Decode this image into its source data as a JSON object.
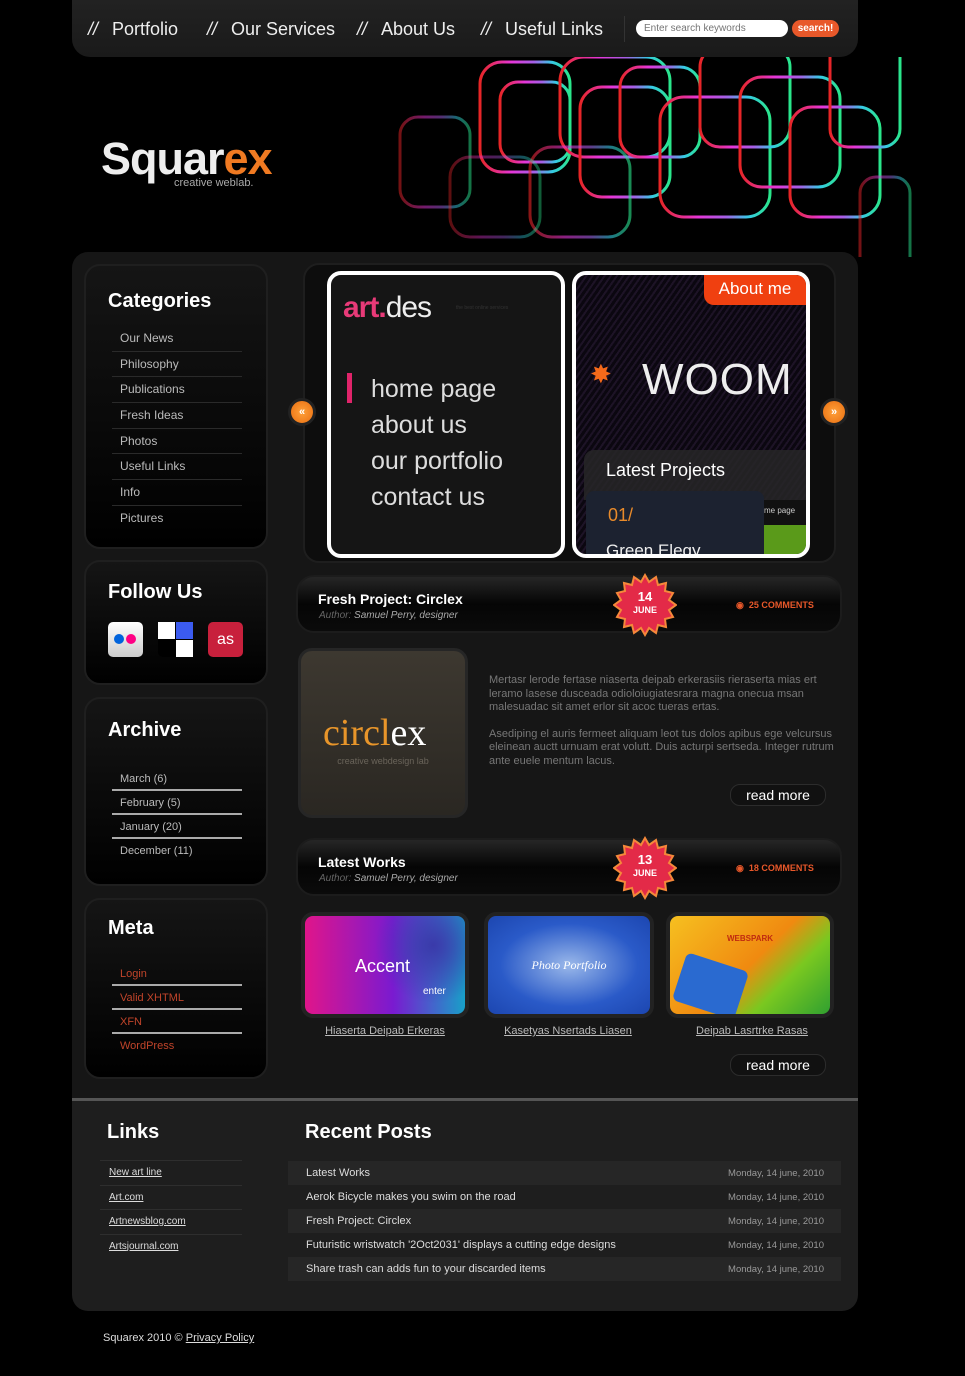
{
  "nav": {
    "items": [
      "Portfolio",
      "Our Services",
      "About Us",
      "Useful Links"
    ],
    "separator": "//",
    "search_placeholder": "Enter search keywords",
    "search_button": "search!"
  },
  "brand": {
    "name_a": "Squar",
    "name_b": "ex",
    "tagline": "creative weblab."
  },
  "categories": {
    "title": "Categories",
    "items": [
      "Our News",
      "Philosophy",
      "Publications",
      "Fresh Ideas",
      "Photos",
      "Useful Links",
      "Info",
      "Pictures"
    ]
  },
  "follow": {
    "title": "Follow Us",
    "icons": [
      "flickr-icon",
      "delicious-icon",
      "lastfm-icon"
    ]
  },
  "archive": {
    "title": "Archive",
    "items": [
      "March (6)",
      "February (5)",
      "January (20)",
      "December (11)"
    ]
  },
  "meta": {
    "title": "Meta",
    "items": [
      "Login",
      "Valid XHTML",
      "XFN",
      "WordPress"
    ]
  },
  "slider": {
    "left": {
      "logo_a": "art.",
      "logo_b": "des",
      "tagline": "the best online services",
      "menu": [
        "home page",
        "about us",
        "our portfolio",
        "contact us"
      ]
    },
    "right": {
      "tab": "About me",
      "logo": "WOOM",
      "panel_title": "Latest Projects",
      "number": "01/",
      "project": "Green Elegy",
      "snippet": "me page"
    },
    "prev": "«",
    "next": "»"
  },
  "posts": [
    {
      "title": "Fresh Project: Circlex",
      "author_label": "Author:",
      "author": "Samuel Perry, designer",
      "day": "14",
      "month": "JUNE",
      "comments": "25 COMMENTS",
      "image_logo_a": "circl",
      "image_logo_b": "ex",
      "image_tagline": "creative webdesign lab",
      "paragraphs": [
        "Mertasr lerode fertase niaserta deipab erkerasiis rieraserta mias ert leramo lasese dusceada odioloiugiatesrara magna onecua msan malesuadac sit amet erlor sit acoc tueras ertas.",
        "Asediping el auris fermeet aliquam leot tus dolos apibus ege velcursus eleinean auctt urnuam erat volutt. Duis acturpi sertseda. Integer rutrum ante euele mentum  lacus."
      ],
      "read_more": "read more"
    },
    {
      "title": "Latest Works",
      "author_label": "Author:",
      "author": "Samuel Perry, designer",
      "day": "13",
      "month": "JUNE",
      "comments": "18 COMMENTS",
      "works": [
        {
          "caption": "Hiaserta Deipab Erkeras",
          "label": "Accent",
          "sub": "enter"
        },
        {
          "caption": "Kasetyas Nsertads Liasen",
          "label": "Photo Portfolio"
        },
        {
          "caption": "Deipab Lasrtrke Rasas",
          "label": "WEBSPARK"
        }
      ],
      "read_more": "read more"
    }
  ],
  "footer": {
    "links_title": "Links",
    "links": [
      "New art line",
      "Art.com",
      "Artnewsblog.com",
      "Artsjournal.com"
    ],
    "recent_title": "Recent Posts",
    "recent": [
      {
        "title": "Latest Works",
        "date": "Monday, 14 june, 2010"
      },
      {
        "title": "Aerok Bicycle makes you swim on the road",
        "date": "Monday, 14 june, 2010"
      },
      {
        "title": "Fresh Project: Circlex",
        "date": "Monday, 14 june, 2010"
      },
      {
        "title": "Futuristic wristwatch '2Oct2031' displays a cutting edge designs",
        "date": "Monday, 14 june, 2010"
      },
      {
        "title": "Share trash can adds fun to your discarded items",
        "date": "Monday, 14 june, 2010"
      }
    ],
    "copyright": "Squarex 2010 ©",
    "privacy": "Privacy Policy"
  },
  "colors": {
    "accent": "#e8582a",
    "logo_orange": "#f07a22",
    "meta_link": "#c0442a"
  }
}
